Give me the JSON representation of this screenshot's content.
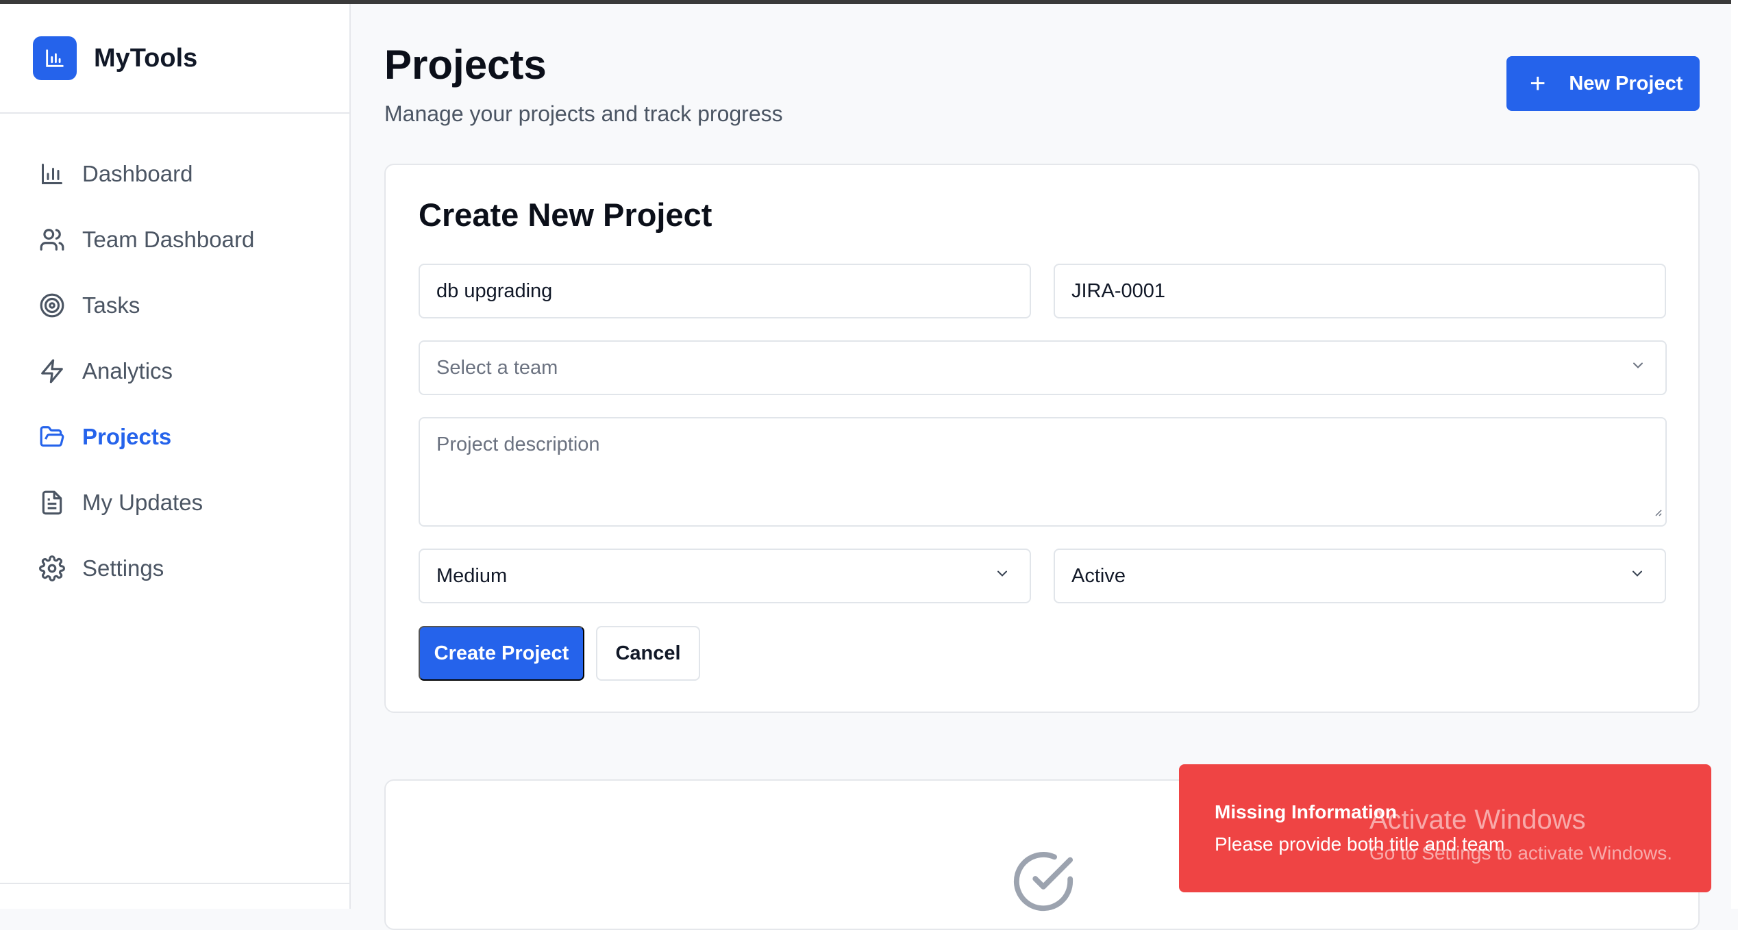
{
  "app": {
    "name": "MyTools"
  },
  "sidebar": {
    "items": [
      {
        "label": "Dashboard",
        "icon": "bar-chart-icon"
      },
      {
        "label": "Team Dashboard",
        "icon": "users-icon"
      },
      {
        "label": "Tasks",
        "icon": "target-icon"
      },
      {
        "label": "Analytics",
        "icon": "bolt-icon"
      },
      {
        "label": "Projects",
        "icon": "folder-open-icon",
        "active": true
      },
      {
        "label": "My Updates",
        "icon": "document-icon"
      },
      {
        "label": "Settings",
        "icon": "gear-icon"
      }
    ]
  },
  "header": {
    "title": "Projects",
    "subtitle": "Manage your projects and track progress",
    "new_button": "New Project"
  },
  "form": {
    "title": "Create New Project",
    "project_title": "db upgrading",
    "ticket_id": "JIRA-0001",
    "team_placeholder": "Select a team",
    "description_placeholder": "Project description",
    "priority": "Medium",
    "status": "Active",
    "create_button": "Create Project",
    "cancel_button": "Cancel"
  },
  "toast": {
    "title": "Missing Information",
    "message": "Please provide both title and team"
  },
  "watermark": {
    "line1": "Activate Windows",
    "line2": "Go to Settings to activate Windows."
  },
  "colors": {
    "accent": "#2563eb",
    "toast_error": "#ef4444"
  }
}
